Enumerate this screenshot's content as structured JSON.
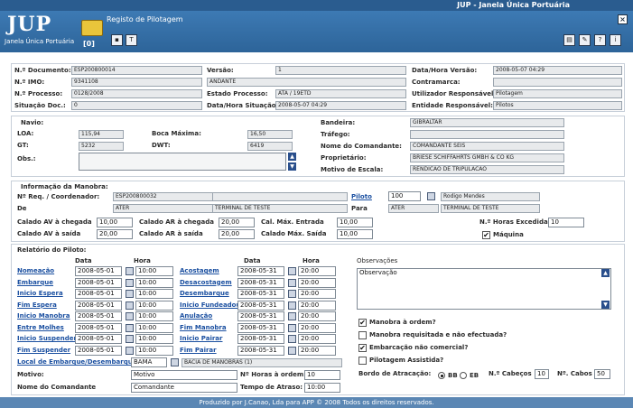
{
  "window": {
    "title": "JUP - Janela Única Portuária"
  },
  "header": {
    "logo": "JUP",
    "subtitle": "Janela Única Portuária",
    "page_title": "Registo de Pilotagem",
    "counter": "[0]"
  },
  "s1": {
    "ndoc_l": "N.º Documento:",
    "ndoc": "ESP200800014",
    "versao_l": "Versão:",
    "versao": "1",
    "dhv_l": "Data/Hora Versão:",
    "dhv": "2008-05-07 04:29",
    "imo_l": "N.º IMO:",
    "imo": "9341108",
    "navio": "ANDANTE",
    "contra_l": "Contramarca:",
    "contra": "",
    "proc_l": "N.º Processo:",
    "proc": "0128/2008",
    "estado_l": "Estado Processo:",
    "estado": "ATA / 19ETD",
    "user_l": "Utilizador Responsável:",
    "user": "Pilotagem",
    "sit_l": "Situação Doc.:",
    "sit": "0",
    "dhs_l": "Data/Hora Situação:",
    "dhs": "2008-05-07 04:29",
    "ent_l": "Entidade Responsável:",
    "ent": "Pilotos"
  },
  "s2": {
    "navio_l": "Navio:",
    "loa_l": "LOA:",
    "loa": "115,94",
    "boca_l": "Boca Máxima:",
    "boca": "16,50",
    "gt_l": "GT:",
    "gt": "5232",
    "dwt_l": "DWT:",
    "dwt": "6419",
    "obs_l": "Obs.:",
    "band_l": "Bandeira:",
    "band": "GIBRALTAR",
    "traf_l": "Tráfego:",
    "traf": "",
    "com_l": "Nome do Comandante:",
    "com": "COMANDANTE SEIS",
    "prop_l": "Proprietário:",
    "prop": "BRIESE SCHIFFAHRTS GMBH & CO KG",
    "mot_l": "Motivo de Escala:",
    "mot": "RENDICAO DE TRIPULACAO"
  },
  "s3": {
    "title": "Informação da Manobra:",
    "req_l": "Nº Req. / Coordenador:",
    "req": "ESP200800032",
    "req2": "",
    "piloto_l": "Piloto",
    "piloto_n": "100",
    "piloto": "Rodigo Mendes",
    "de_l": "De",
    "de_c": "ATER",
    "de": "TERMINAL DE TESTE",
    "para_l": "Para",
    "para_c": "ATER",
    "para": "TERMINAL DE TESTE",
    "cav_c_l": "Calado AV à chegada",
    "cav_c": "10,00",
    "car_c_l": "Calado AR à chegada",
    "car_c": "20,00",
    "cme_l": "Cal. Máx. Entrada",
    "cme": "10,00",
    "nhe_l": "N.º Horas Excedidas",
    "nhe": "10",
    "cav_s_l": "Calado AV à saída",
    "cav_s": "20,00",
    "car_s_l": "Calado AR à saída",
    "car_s": "20,00",
    "cms_l": "Calado Máx. Saída",
    "cms": "10,00",
    "maq_l": "Máquina"
  },
  "s4": {
    "title": "Relatório do Piloto:",
    "data_h": "Data",
    "hora_h": "Hora",
    "left": [
      {
        "label": "Nomeação",
        "date": "2008-05-01",
        "time": "10:00"
      },
      {
        "label": "Embarque",
        "date": "2008-05-01",
        "time": "10:00"
      },
      {
        "label": "Inicio Espera",
        "date": "2008-05-01",
        "time": "10:00"
      },
      {
        "label": "Fim Espera",
        "date": "2008-05-01",
        "time": "10:00"
      },
      {
        "label": "Inicio Manobra",
        "date": "2008-05-01",
        "time": "10:00"
      },
      {
        "label": "Entre Molhes",
        "date": "2008-05-01",
        "time": "10:00"
      },
      {
        "label": "Inicio Suspender",
        "date": "2008-05-01",
        "time": "10:00"
      },
      {
        "label": "Fim Suspender",
        "date": "2008-05-01",
        "time": "10:00"
      }
    ],
    "right": [
      {
        "label": "Acostagem",
        "date": "2008-05-31",
        "time": "20:00"
      },
      {
        "label": "Desacostagem",
        "date": "2008-05-31",
        "time": "20:00"
      },
      {
        "label": "Desembarque",
        "date": "2008-05-31",
        "time": "20:00"
      },
      {
        "label": "Inicio Fundeadouro",
        "date": "2008-05-31",
        "time": "20:00"
      },
      {
        "label": "Anulação",
        "date": "2008-05-31",
        "time": "20:00"
      },
      {
        "label": "Fim Manobra",
        "date": "2008-05-31",
        "time": "20:00"
      },
      {
        "label": "Inicio Pairar",
        "date": "2008-05-31",
        "time": "20:00"
      },
      {
        "label": "Fim Pairar",
        "date": "2008-05-31",
        "time": "20:00"
      }
    ],
    "local_l": "Local de Embarque/Desembarque:",
    "local_c": "BAMA",
    "local": "BACIA DE MANOBRAS (1)",
    "motivo_l": "Motivo:",
    "motivo": "Motivo",
    "horas_l": "Nº Horas à ordem:",
    "horas": "10",
    "nc_l": "Nome do Comandante",
    "nc": "Comandante",
    "ta_l": "Tempo de Atraso:",
    "ta": "10:00",
    "obs_l": "Observações",
    "obs": "Observação",
    "chk": [
      {
        "label": "Manobra à ordem?",
        "checked": "✔"
      },
      {
        "label": "Manobra requisitada e não efectuada?",
        "checked": ""
      },
      {
        "label": "Embarcação não comercial?",
        "checked": "✔"
      },
      {
        "label": "Pilotagem Assistida?",
        "checked": ""
      }
    ],
    "bordo_l": "Bordo de Atracação:",
    "bb": "BB",
    "eb": "EB",
    "ncab_l": "N.º Cabeços",
    "ncab": "10",
    "ncabos_l": "Nº. Cabos",
    "ncabos": "50"
  },
  "footer": {
    "text": "Produzido por J.Canao, Lda para APP © 2008 Todos os direitos reservados."
  }
}
